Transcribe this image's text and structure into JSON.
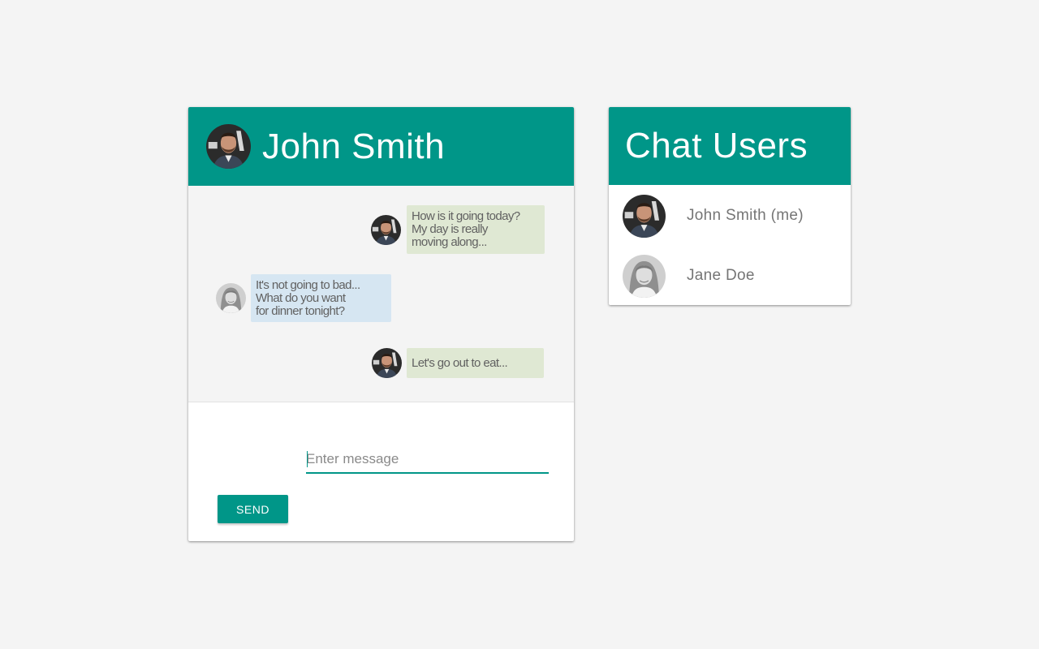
{
  "chat": {
    "header": {
      "name": "John Smith",
      "avatar": "john-smith-avatar"
    },
    "messages": [
      {
        "sender": "John Smith",
        "side": "mine",
        "avatar": "john-smith-avatar",
        "text": "How is it going today?\nMy day is really\nmoving along..."
      },
      {
        "sender": "Jane Doe",
        "side": "theirs",
        "avatar": "jane-doe-avatar",
        "text": "It's not going to bad...\nWhat do you want\nfor dinner tonight?"
      },
      {
        "sender": "John Smith",
        "side": "mine",
        "avatar": "john-smith-avatar",
        "text": "Let's go out to eat..."
      }
    ],
    "composer": {
      "placeholder": "Enter message",
      "value": "",
      "send_label": "SEND"
    }
  },
  "users": {
    "title": "Chat Users",
    "items": [
      {
        "name": "John Smith (me)",
        "avatar": "john-smith-avatar"
      },
      {
        "name": "Jane Doe",
        "avatar": "jane-doe-avatar"
      }
    ]
  },
  "colors": {
    "primary": "#009688",
    "background": "#f4f4f4",
    "bubble_mine": "#dfe8d3",
    "bubble_theirs": "#d6e6f2",
    "text_secondary": "#757575"
  }
}
